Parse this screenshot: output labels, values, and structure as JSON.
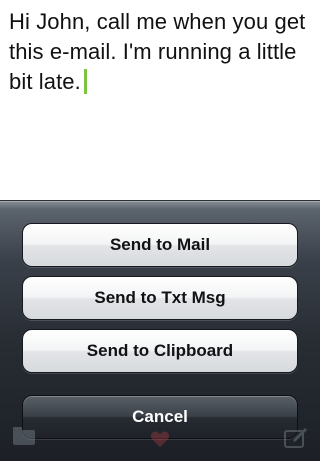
{
  "note": {
    "text": "Hi John, call me when you get this e-mail. I'm running a little bit late."
  },
  "action_sheet": {
    "buttons": [
      {
        "label": "Send to Mail"
      },
      {
        "label": "Send to Txt Msg"
      },
      {
        "label": "Send to Clipboard"
      }
    ],
    "cancel_label": "Cancel"
  },
  "colors": {
    "caret": "#7fc345",
    "sheet_background": "#3a4049",
    "cancel_button": "#2b3037"
  },
  "toolbar_icons": [
    "folder-icon",
    "heart-icon",
    "compose-icon"
  ]
}
